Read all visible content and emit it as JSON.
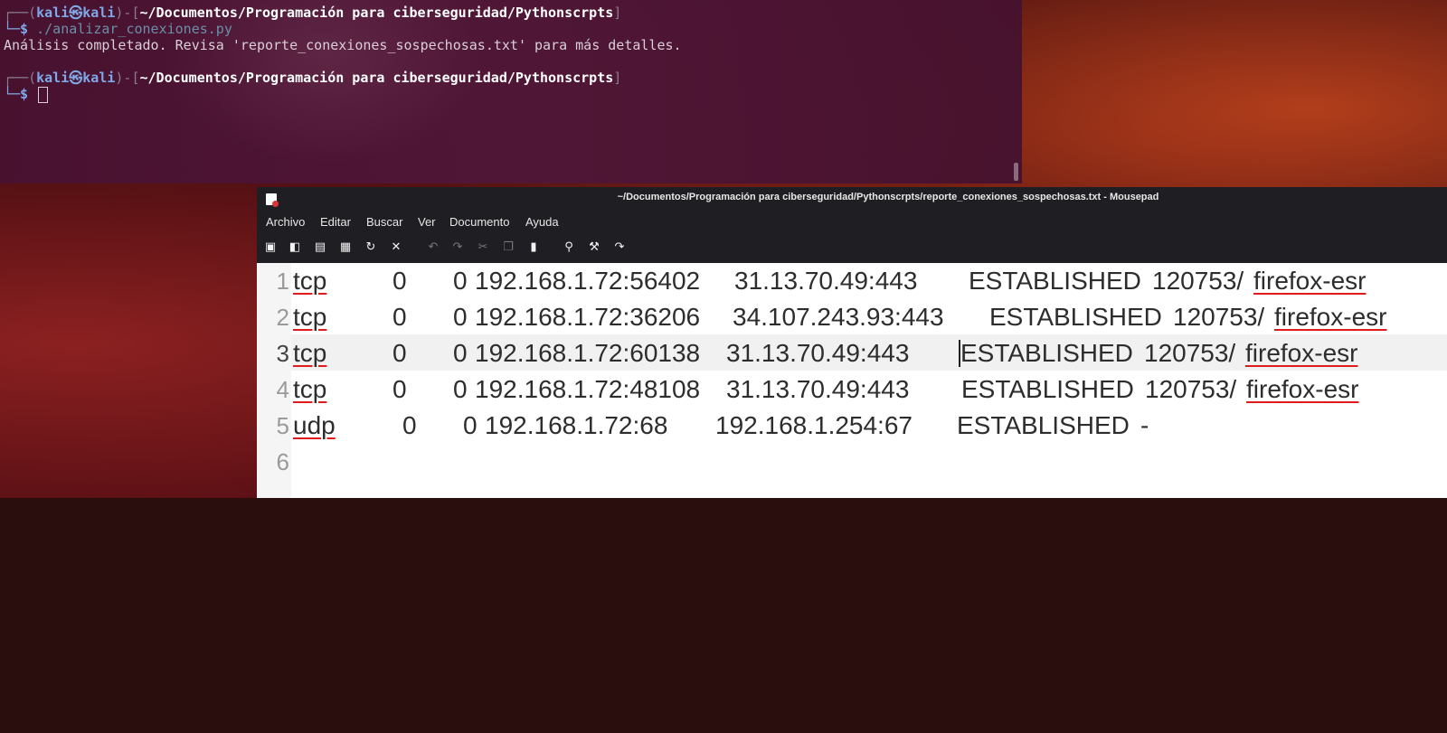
{
  "terminal": {
    "prompt1": {
      "open": "┌──(",
      "user": "kali",
      "at": "㉿",
      "host": "kali",
      "mid": ")-[",
      "path": "~/Documentos/Programación para ciberseguridad/Pythonscrpts",
      "close": "]"
    },
    "prompt1_cmd": {
      "symbol": "└─$",
      "command": " ./analizar_conexiones.py"
    },
    "output": "Análisis completado. Revisa 'reporte_conexiones_sospechosas.txt' para más detalles.",
    "prompt2": {
      "open": "┌──(",
      "user": "kali",
      "at": "㉿",
      "host": "kali",
      "mid": ")-[",
      "path": "~/Documentos/Programación para ciberseguridad/Pythonscrpts",
      "close": "]"
    },
    "prompt2_cmd": {
      "symbol": "└─$"
    }
  },
  "editor": {
    "title": "~/Documentos/Programación para ciberseguridad/Pythonscrpts/reporte_conexiones_sospechosas.txt - Mousepad",
    "menu": [
      "Archivo",
      "Editar",
      "Buscar",
      "Ver",
      "Documento",
      "Ayuda"
    ],
    "toolbar_icons": [
      "new-file-icon",
      "new-window-icon",
      "save-icon",
      "save-as-icon",
      "reload-icon",
      "close-icon",
      "undo-icon",
      "redo-icon",
      "cut-icon",
      "copy-icon",
      "paste-icon",
      "find-icon",
      "find-replace-icon",
      "goto-icon"
    ],
    "line_numbers": [
      "1",
      "2",
      "3",
      "4",
      "5",
      "6"
    ],
    "lines": [
      {
        "proto": "tcp",
        "recvq": "0",
        "sendq": "0",
        "local": "192.168.1.72:56402",
        "remote": "31.13.70.49:443",
        "state": "ESTABLISHED",
        "pid": "120753/",
        "prog": "firefox-esr"
      },
      {
        "proto": "tcp",
        "recvq": "0",
        "sendq": "0",
        "local": "192.168.1.72:36206",
        "remote": "34.107.243.93:443",
        "state": "ESTABLISHED",
        "pid": "120753/",
        "prog": "firefox-esr"
      },
      {
        "proto": "tcp",
        "recvq": "0",
        "sendq": "0",
        "local": "192.168.1.72:60138",
        "remote": "31.13.70.49:443",
        "state": "ESTABLISHED",
        "pid": "120753/",
        "prog": "firefox-esr"
      },
      {
        "proto": "tcp",
        "recvq": "0",
        "sendq": "0",
        "local": "192.168.1.72:48108",
        "remote": "31.13.70.49:443",
        "state": "ESTABLISHED",
        "pid": "120753/",
        "prog": "firefox-esr"
      },
      {
        "proto": "udp",
        "recvq": "0",
        "sendq": "0",
        "local": "192.168.1.72:68",
        "remote": "192.168.1.254:67",
        "state": "ESTABLISHED",
        "pid": "-",
        "prog": ""
      }
    ]
  }
}
